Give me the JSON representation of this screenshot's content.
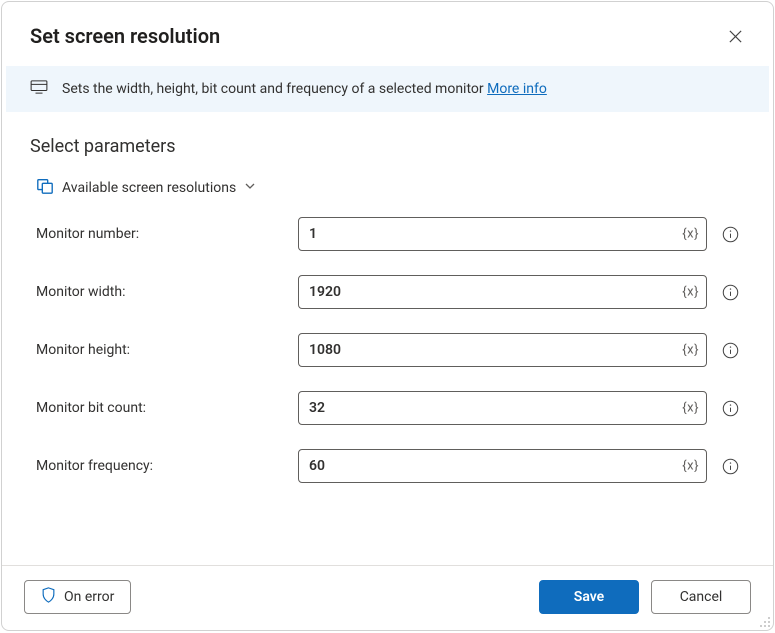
{
  "header": {
    "title": "Set screen resolution"
  },
  "banner": {
    "text": "Sets the width, height, bit count and frequency of a selected monitor ",
    "link_label": "More info"
  },
  "section": {
    "title": "Select parameters",
    "variables_link": "Available screen resolutions"
  },
  "fields": {
    "monitor_number": {
      "label": "Monitor number:",
      "value": "1"
    },
    "monitor_width": {
      "label": "Monitor width:",
      "value": "1920"
    },
    "monitor_height": {
      "label": "Monitor height:",
      "value": "1080"
    },
    "monitor_bit_count": {
      "label": "Monitor bit count:",
      "value": "32"
    },
    "monitor_frequency": {
      "label": "Monitor frequency:",
      "value": "60"
    }
  },
  "brace_hint": "{x}",
  "footer": {
    "on_error": "On error",
    "save": "Save",
    "cancel": "Cancel"
  }
}
